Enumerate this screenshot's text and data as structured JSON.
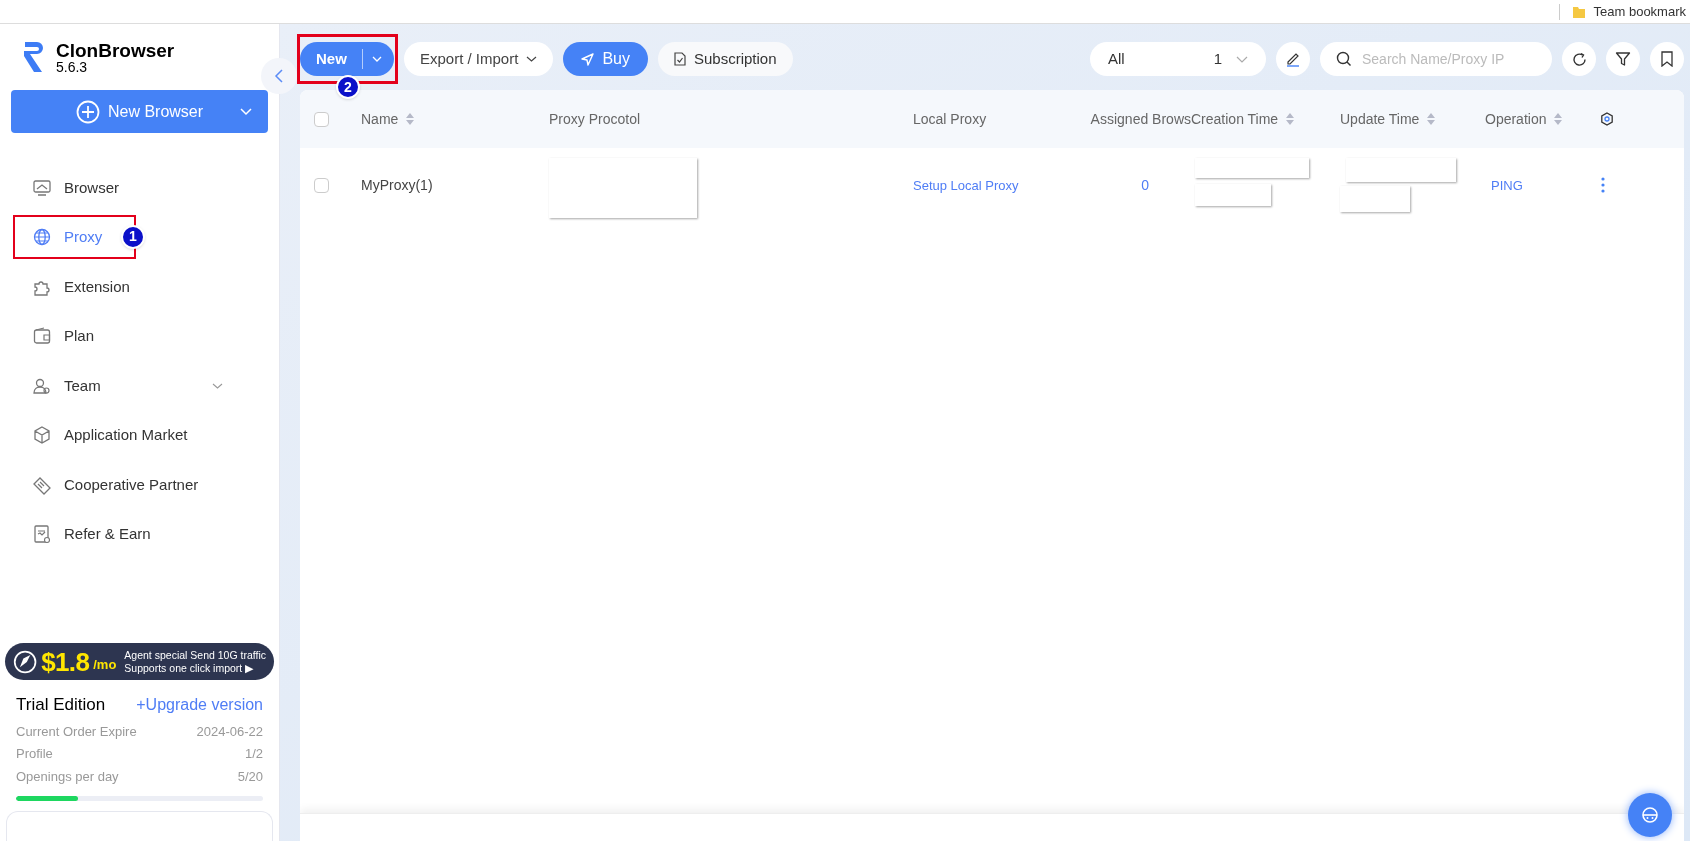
{
  "bookmarks_bar": {
    "item": "Team bookmark"
  },
  "app": {
    "name": "ClonBrowser",
    "version": "5.6.3"
  },
  "new_browser_button": {
    "label": "New Browser"
  },
  "sidebar": {
    "items": [
      {
        "label": "Browser",
        "selected": false
      },
      {
        "label": "Proxy",
        "selected": true,
        "annotation": "1"
      },
      {
        "label": "Extension",
        "selected": false
      },
      {
        "label": "Plan",
        "selected": false
      },
      {
        "label": "Team",
        "selected": false,
        "expandable": true
      },
      {
        "label": "Application Market",
        "selected": false
      },
      {
        "label": "Cooperative Partner",
        "selected": false
      },
      {
        "label": "Refer & Earn",
        "selected": false
      }
    ]
  },
  "promo": {
    "price": "$1.8",
    "unit": "/mo",
    "line_1": "Agent special Send 10G traffic",
    "line_2": "Supports one click import ▶"
  },
  "plan": {
    "edition": "Trial Edition",
    "upgrade_link": "+Upgrade version",
    "stats": [
      {
        "label": "Current Order Expire",
        "value": "2024-06-22"
      },
      {
        "label": "Profile",
        "value": "1/2"
      },
      {
        "label": "Openings per day",
        "value": "5/20",
        "level": 0.25
      }
    ]
  },
  "toolbar": {
    "new_button": {
      "label": "New",
      "annotation": "2"
    },
    "export_button": "Export / Import",
    "buy_button": "Buy",
    "subscription_button": "Subscription",
    "group_select": {
      "value": "All",
      "count": "1"
    },
    "search": {
      "placeholder": "Search Name/Proxy IP"
    }
  },
  "table": {
    "select_all": {
      "checked": false
    },
    "columns": [
      {
        "label": "Name",
        "sortable": true
      },
      {
        "label": "Proxy Procotol",
        "sortable": false
      },
      {
        "label": "Local Proxy",
        "sortable": false
      },
      {
        "label": "Assigned Brows",
        "sortable": false
      },
      {
        "label": "Creation Time",
        "sortable": true
      },
      {
        "label": "Update Time",
        "sortable": true
      },
      {
        "label": "Operation",
        "sortable": true
      }
    ],
    "rows": [
      {
        "checked": false,
        "name": "MyProxy(1)",
        "local_proxy": "Setup Local Proxy",
        "assigned": "0",
        "operation": "PING"
      }
    ]
  }
}
